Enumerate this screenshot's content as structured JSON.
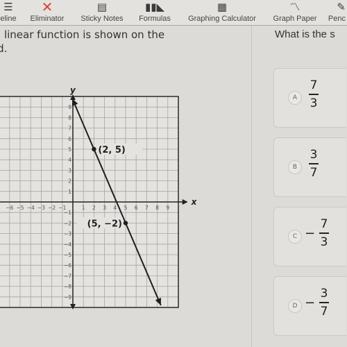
{
  "toolbar": {
    "items": [
      {
        "label": "eline",
        "icon": "lines-icon"
      },
      {
        "label": "Eliminator",
        "icon": "x-icon"
      },
      {
        "label": "Sticky Notes",
        "icon": "sticky-note-icon"
      },
      {
        "label": "Formulas",
        "icon": "books-icon"
      },
      {
        "label": "Graphing Calculator",
        "icon": "calculator-icon"
      },
      {
        "label": "Graph Paper",
        "icon": "line-graph-icon"
      },
      {
        "label": "Penc",
        "icon": "pencil-icon"
      }
    ],
    "eliminator_color": "#d9442e"
  },
  "question": {
    "left_line1": "a linear function is shown on the",
    "left_line2": "id.",
    "right_prompt": "What is the s"
  },
  "graph": {
    "x_axis_label": "x",
    "y_axis_label": "y",
    "x_ticks": [
      "-6",
      "-5",
      "-4",
      "-3",
      "-2",
      "-1",
      "1",
      "2",
      "3",
      "4",
      "5",
      "6",
      "7",
      "8",
      "9"
    ],
    "y_ticks": [
      "9",
      "8",
      "7",
      "6",
      "5",
      "4",
      "3",
      "2",
      "1",
      "-1",
      "-2",
      "-3",
      "-4",
      "-5",
      "-6",
      "-7",
      "-8",
      "-9"
    ],
    "points": [
      {
        "x": 2,
        "y": 5,
        "label": "(2, 5)"
      },
      {
        "x": 5,
        "y": -2,
        "label": "(5, −2)"
      }
    ],
    "line": {
      "slope": -2.3333,
      "through": [
        2,
        5
      ],
      "arrows": "both"
    }
  },
  "choices": [
    {
      "letter": "A",
      "sign": "",
      "num": "7",
      "den": "3"
    },
    {
      "letter": "B",
      "sign": "",
      "num": "3",
      "den": "7"
    },
    {
      "letter": "C",
      "sign": "−",
      "num": "7",
      "den": "3"
    },
    {
      "letter": "D",
      "sign": "−",
      "num": "3",
      "den": "7"
    }
  ]
}
